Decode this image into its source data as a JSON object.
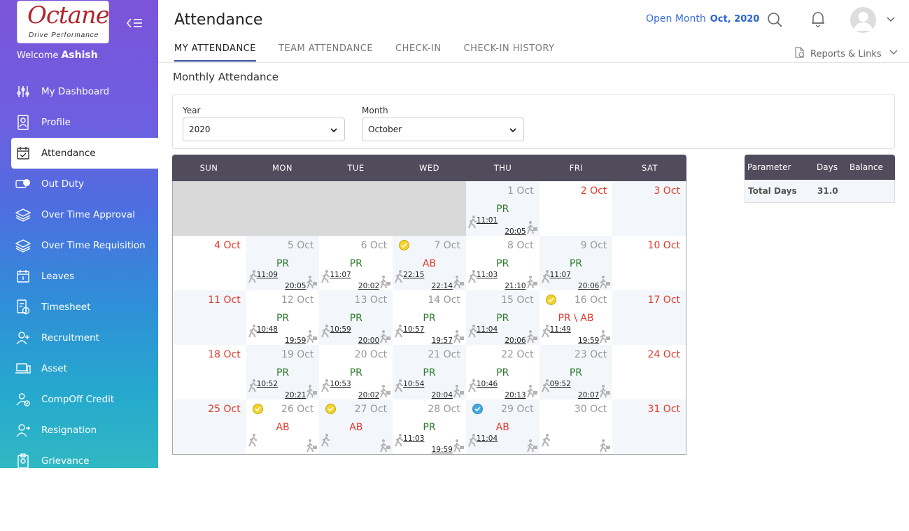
{
  "app": {
    "logo_text": "Octane",
    "logo_tagline": "Drive Performance",
    "welcome_label": "Welcome",
    "user_name": "Ashish"
  },
  "sidebar": {
    "items": [
      {
        "label": "My Dashboard",
        "icon": "sliders-icon"
      },
      {
        "label": "Profile",
        "icon": "id-card-icon"
      },
      {
        "label": "Attendance",
        "icon": "calendar-icon",
        "active": true
      },
      {
        "label": "Out Duty",
        "icon": "out-duty-icon"
      },
      {
        "label": "Over Time Approval",
        "icon": "layers-icon"
      },
      {
        "label": "Over Time Requisition",
        "icon": "layers-icon"
      },
      {
        "label": "Leaves",
        "icon": "leaves-calendar-icon"
      },
      {
        "label": "Timesheet",
        "icon": "timesheet-icon"
      },
      {
        "label": "Recruitment",
        "icon": "add-user-icon"
      },
      {
        "label": "Asset",
        "icon": "laptop-icon"
      },
      {
        "label": "CompOff Credit",
        "icon": "user-check-icon"
      },
      {
        "label": "Resignation",
        "icon": "user-exit-icon"
      },
      {
        "label": "Grievance",
        "icon": "grievance-icon"
      }
    ]
  },
  "header": {
    "title": "Attendance",
    "open_month_label": "Open Month",
    "open_month_value": "Oct, 2020"
  },
  "tabs": [
    {
      "label": "MY ATTENDANCE",
      "active": true
    },
    {
      "label": "TEAM ATTENDANCE"
    },
    {
      "label": "CHECK-IN"
    },
    {
      "label": "CHECK-IN HISTORY"
    }
  ],
  "reports_label": "Reports & Links",
  "section_title": "Monthly Attendance",
  "filters": {
    "year_label": "Year",
    "year_value": "2020",
    "month_label": "Month",
    "month_value": "October"
  },
  "calendar": {
    "weekdays": [
      "SUN",
      "MON",
      "TUE",
      "WED",
      "THU",
      "FRI",
      "SAT"
    ],
    "weeks": [
      [
        {
          "empty": true
        },
        {
          "empty": true
        },
        {
          "empty": true
        },
        {
          "empty": true
        },
        {
          "date": "1 Oct",
          "status": "PR",
          "in": "11:01",
          "out": "20:05"
        },
        {
          "date": "2 Oct",
          "weekend": true
        },
        {
          "date": "3 Oct",
          "weekend": true
        }
      ],
      [
        {
          "date": "4 Oct",
          "weekend": true
        },
        {
          "date": "5 Oct",
          "status": "PR",
          "in": "11:09",
          "out": "20:05"
        },
        {
          "date": "6 Oct",
          "status": "PR",
          "in": "11:07",
          "out": "20:02"
        },
        {
          "date": "7 Oct",
          "status": "AB",
          "in": "22:15",
          "out": "22:14",
          "badge": "yellow"
        },
        {
          "date": "8 Oct",
          "status": "PR",
          "in": "11:03",
          "out": "21:10"
        },
        {
          "date": "9 Oct",
          "status": "PR",
          "in": "11:07",
          "out": "20:06"
        },
        {
          "date": "10 Oct",
          "weekend": true
        }
      ],
      [
        {
          "date": "11 Oct",
          "weekend": true
        },
        {
          "date": "12 Oct",
          "status": "PR",
          "in": "10:48",
          "out": "19:59"
        },
        {
          "date": "13 Oct",
          "status": "PR",
          "in": "10:59",
          "out": "20:00"
        },
        {
          "date": "14 Oct",
          "status": "PR",
          "in": "10:57",
          "out": "19:57"
        },
        {
          "date": "15 Oct",
          "status": "PR",
          "in": "11:04",
          "out": "20:06"
        },
        {
          "date": "16 Oct",
          "status": "PR \\ AB",
          "in": "11:49",
          "out": "19:59",
          "badge": "yellow"
        },
        {
          "date": "17 Oct",
          "weekend": true
        }
      ],
      [
        {
          "date": "18 Oct",
          "weekend": true
        },
        {
          "date": "19 Oct",
          "status": "PR",
          "in": "10:52",
          "out": "20:21"
        },
        {
          "date": "20 Oct",
          "status": "PR",
          "in": "10:53",
          "out": "20:02"
        },
        {
          "date": "21 Oct",
          "status": "PR",
          "in": "10:54",
          "out": "20:04"
        },
        {
          "date": "22 Oct",
          "status": "PR",
          "in": "10:46",
          "out": "20:13"
        },
        {
          "date": "23 Oct",
          "status": "PR",
          "in": "09:52",
          "out": "20:07"
        },
        {
          "date": "24 Oct",
          "weekend": true
        }
      ],
      [
        {
          "date": "25 Oct",
          "weekend": true
        },
        {
          "date": "26 Oct",
          "status": "AB",
          "badge": "yellow"
        },
        {
          "date": "27 Oct",
          "status": "AB",
          "badge": "yellow"
        },
        {
          "date": "28 Oct",
          "status": "PR",
          "in": "11:03",
          "out": "19:59"
        },
        {
          "date": "29 Oct",
          "status": "AB",
          "in": "11:04",
          "badge": "blue"
        },
        {
          "date": "30 Oct"
        },
        {
          "date": "31 Oct",
          "weekend": true
        }
      ]
    ]
  },
  "summary": {
    "headers": [
      "Parameter",
      "Days",
      "Balance"
    ],
    "rows": [
      {
        "parameter": "Total Days",
        "days": "31.0",
        "balance": ""
      }
    ]
  },
  "colors": {
    "present": "#2d7a2d",
    "absent": "#e03a2c",
    "header_bg": "#514c5c",
    "accent": "#3a6fd6"
  }
}
